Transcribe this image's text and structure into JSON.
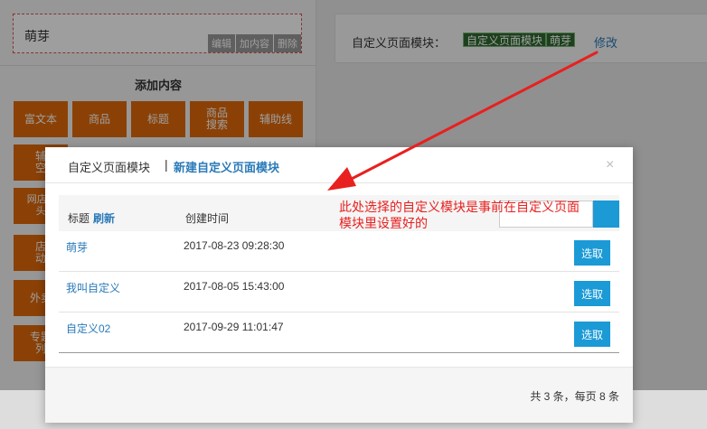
{
  "background": {
    "mengya_label": "萌芽",
    "mini_actions": [
      "编辑",
      "加内容",
      "删除"
    ],
    "add_content_title": "添加内容",
    "widgets": [
      "富文本",
      "商品",
      "标题",
      "商品\n搜索",
      "辅助线",
      "辅\n空",
      "网店lo\n头",
      "店\n动",
      "外卖",
      "专题\n列"
    ],
    "card_label": "自定义页面模块：",
    "card_tags": [
      "自定义页面模块",
      "萌芽"
    ],
    "card_modify": "修改"
  },
  "dialog": {
    "tab_active": "自定义页面模块",
    "tab_separator": "|",
    "tab_new": "新建自定义页面模块",
    "close_icon": "×",
    "table": {
      "col_title": "标题",
      "col_refresh": "刷新",
      "col_time": "创建时间",
      "rows": [
        {
          "name": "萌芽",
          "time": "2017-08-23 09:28:30",
          "action": "选取"
        },
        {
          "name": "我叫自定义",
          "time": "2017-08-05 15:43:00",
          "action": "选取"
        },
        {
          "name": "自定义02",
          "time": "2017-09-29 11:01:47",
          "action": "选取"
        }
      ]
    },
    "pager_text": "共 3 条，每页 8 条"
  },
  "annotation": {
    "line1": "此处选择的自定义模块是事前在自定义页面",
    "line2": "模块里设置好的",
    "color": "#e8201f"
  },
  "colors": {
    "accent": "#1b9ad6",
    "link": "#2a7ab8",
    "widget": "#e06a0a",
    "tag": "#2f6a2f"
  }
}
